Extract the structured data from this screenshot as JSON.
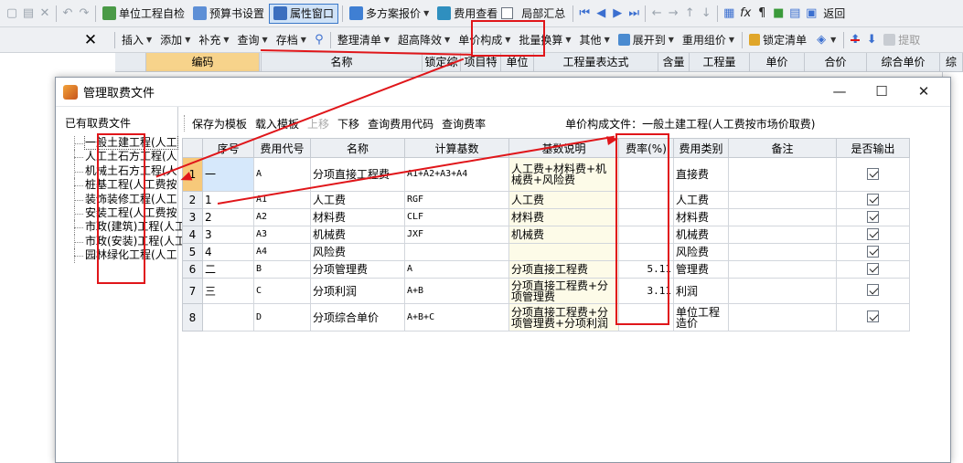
{
  "toolbar1": {
    "self_check": "单位工程自检",
    "budget_settings": "预算书设置",
    "property_window": "属性窗口",
    "multi_quote": "多方案报价",
    "fee_check": "费用查看",
    "partial_summary": "局部汇总",
    "return": "返回"
  },
  "toolbar2": {
    "insert": "插入",
    "add": "添加",
    "supplement": "补充",
    "query": "查询",
    "archive": "存档",
    "organize": "整理清单",
    "overheight": "超高降效",
    "unit_price_composition": "单价构成",
    "batch_convert": "批量换算",
    "other": "其他",
    "expand_to": "展开到",
    "reuse_pricing": "重用组价",
    "lock_list": "锁定清单",
    "extract": "提取"
  },
  "main_grid": {
    "columns": [
      "",
      "编码",
      "",
      "名称",
      "锁定综",
      "项目特",
      "单位",
      "工程量表达式",
      "含量",
      "工程量",
      "单价",
      "合价",
      "综合单价",
      "综"
    ]
  },
  "dialog": {
    "title": "管理取费文件",
    "left_title": "已有取费文件",
    "tree": [
      "一般土建工程(人工",
      "人工土石方工程(人",
      "机械土石方工程(人",
      "桩基工程(人工费按",
      "装饰装修工程(人工",
      "安装工程(人工费按",
      "市政(建筑)工程(人工",
      "市政(安装)工程(人工",
      "园林绿化工程(人工"
    ],
    "toolbar": {
      "save_template": "保存为模板",
      "load_template": "载入模板",
      "move_up": "上移",
      "move_down": "下移",
      "query_fee_code": "查询费用代码",
      "query_fee_rate": "查询费率"
    },
    "file_label": "单价构成文件：一般土建工程(人工费按市场价取费)",
    "table": {
      "headers": [
        "序号",
        "费用代号",
        "名称",
        "计算基数",
        "基数说明",
        "费率(%)",
        "费用类别",
        "备注",
        "是否输出"
      ],
      "rows": [
        {
          "rn": "1",
          "seq": "一",
          "code": "A",
          "name": "分项直接工程费",
          "base": "A1+A2+A3+A4",
          "desc": "人工费+材料费+机械费+风险费",
          "rate": "",
          "category": "直接费",
          "remark": "",
          "output": true
        },
        {
          "rn": "2",
          "seq": "1",
          "code": "A1",
          "name": "人工费",
          "base": "RGF",
          "desc": "人工费",
          "rate": "",
          "category": "人工费",
          "remark": "",
          "output": true
        },
        {
          "rn": "3",
          "seq": "2",
          "code": "A2",
          "name": "材料费",
          "base": "CLF",
          "desc": "材料费",
          "rate": "",
          "category": "材料费",
          "remark": "",
          "output": true
        },
        {
          "rn": "4",
          "seq": "3",
          "code": "A3",
          "name": "机械费",
          "base": "JXF",
          "desc": "机械费",
          "rate": "",
          "category": "机械费",
          "remark": "",
          "output": true
        },
        {
          "rn": "5",
          "seq": "4",
          "code": "A4",
          "name": "风险费",
          "base": "",
          "desc": "",
          "rate": "",
          "category": "风险费",
          "remark": "",
          "output": true
        },
        {
          "rn": "6",
          "seq": "二",
          "code": "B",
          "name": "分项管理费",
          "base": "A",
          "desc": "分项直接工程费",
          "rate": "5.11",
          "category": "管理费",
          "remark": "",
          "output": true
        },
        {
          "rn": "7",
          "seq": "三",
          "code": "C",
          "name": "分项利润",
          "base": "A+B",
          "desc": "分项直接工程费+分项管理费",
          "rate": "3.11",
          "category": "利润",
          "remark": "",
          "output": true
        },
        {
          "rn": "8",
          "seq": "",
          "code": "D",
          "name": "分项综合单价",
          "base": "A+B+C",
          "desc": "分项直接工程费+分项管理费+分项利润",
          "rate": "",
          "category": "单位工程造价",
          "remark": "",
          "output": true
        }
      ]
    }
  },
  "colors": {
    "annotation_red": "#e0161a",
    "selected_header": "#f7d38b"
  }
}
